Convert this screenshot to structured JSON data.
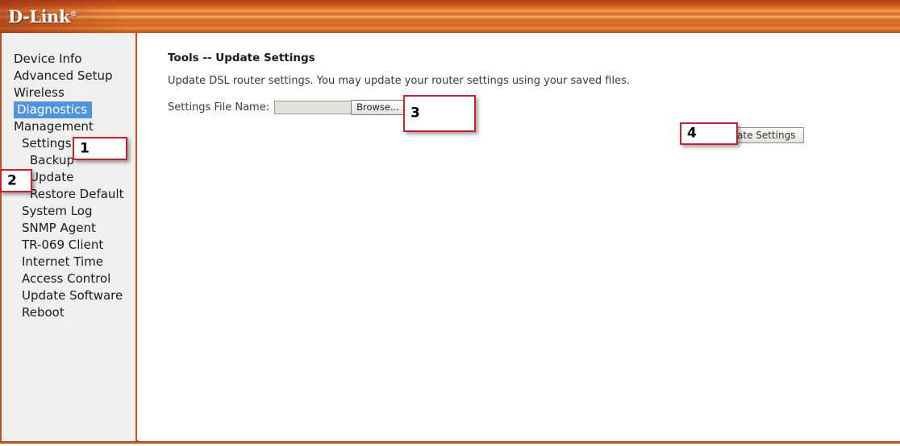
{
  "header": {
    "logo_text": "D-Link",
    "logo_tm": "®",
    "brand_color": "#d2661f",
    "accent_border_color": "#b5541f"
  },
  "sidebar": {
    "background_color": "#f0f0ef",
    "selected_color": "#4f94e0",
    "items": [
      {
        "label": "Device Info",
        "level": 0,
        "selected": false
      },
      {
        "label": "Advanced Setup",
        "level": 0,
        "selected": false
      },
      {
        "label": "Wireless",
        "level": 0,
        "selected": false
      },
      {
        "label": "Diagnostics",
        "level": 0,
        "selected": true
      },
      {
        "label": "Management",
        "level": 0,
        "selected": false
      },
      {
        "label": "Settings",
        "level": 1,
        "selected": false
      },
      {
        "label": "Backup",
        "level": 2,
        "selected": false
      },
      {
        "label": "Update",
        "level": 2,
        "selected": false
      },
      {
        "label": "Restore Default",
        "level": 2,
        "selected": false
      },
      {
        "label": "System Log",
        "level": 1,
        "selected": false
      },
      {
        "label": "SNMP Agent",
        "level": 1,
        "selected": false
      },
      {
        "label": "TR-069 Client",
        "level": 1,
        "selected": false
      },
      {
        "label": "Internet Time",
        "level": 1,
        "selected": false
      },
      {
        "label": "Access Control",
        "level": 1,
        "selected": false
      },
      {
        "label": "Update Software",
        "level": 1,
        "selected": false
      },
      {
        "label": "Reboot",
        "level": 1,
        "selected": false
      }
    ]
  },
  "main": {
    "title": "Tools -- Update Settings",
    "description": "Update DSL router settings. You may update your router settings using your saved files.",
    "file_label": "Settings File Name:",
    "file_value": "",
    "file_placeholder": "",
    "browse_label": "Browse...",
    "update_label": "Update Settings"
  },
  "annotations": {
    "box_border_color": "#cc1f2a",
    "boxes": [
      {
        "number": "1"
      },
      {
        "number": "2"
      },
      {
        "number": "3"
      },
      {
        "number": "4"
      }
    ]
  }
}
